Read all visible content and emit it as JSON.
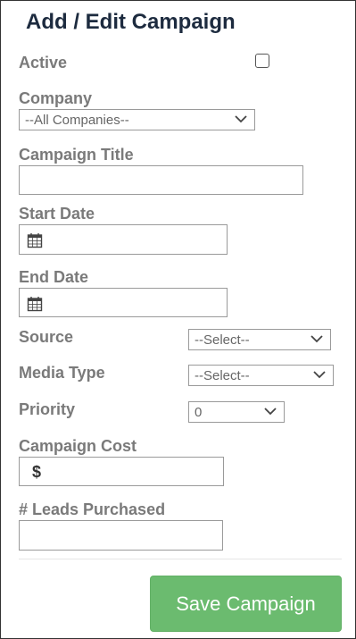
{
  "header": {
    "title": "Add / Edit Campaign"
  },
  "form": {
    "active_label": "Active",
    "company_label": "Company",
    "company_value": "--All Companies--",
    "campaign_title_label": "Campaign Title",
    "campaign_title_value": "",
    "start_date_label": "Start Date",
    "start_date_value": "",
    "end_date_label": "End Date",
    "end_date_value": "",
    "source_label": "Source",
    "source_value": "--Select--",
    "media_type_label": "Media Type",
    "media_type_value": "--Select--",
    "priority_label": "Priority",
    "priority_value": "0",
    "campaign_cost_label": "Campaign Cost",
    "currency_symbol": "$",
    "leads_purchased_label": "# Leads Purchased",
    "leads_purchased_value": ""
  },
  "actions": {
    "save_label": "Save Campaign"
  },
  "icons": {
    "calendar": "calendar-icon",
    "chevron": "chevron-down-icon",
    "checkbox": "checkbox"
  },
  "colors": {
    "title": "#1d2b3f",
    "label": "#7a7a7a",
    "save_button": "#6bbb6f"
  }
}
